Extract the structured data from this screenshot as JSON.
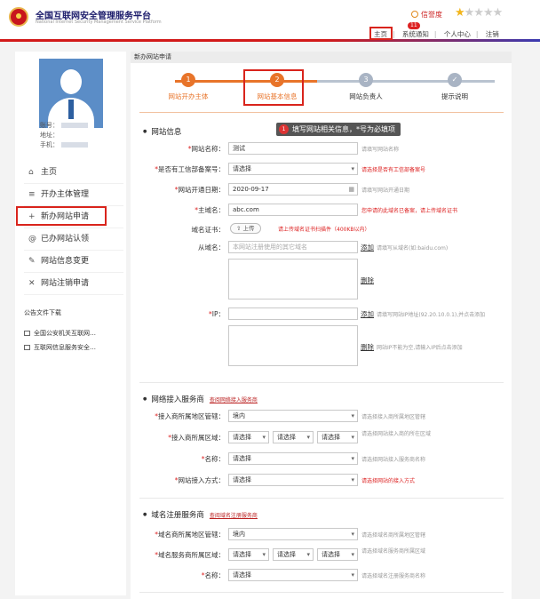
{
  "header": {
    "title": "全国互联网安全管理服务平台",
    "subtitle": "National Internet Security Management Service Platform",
    "credit_label": "信誉度",
    "stars": "★",
    "stars_off": "★★★★",
    "nav": {
      "home": "主页",
      "notify": "系统通知",
      "notify_badge": "11",
      "personal": "个人中心",
      "logout": "注销"
    }
  },
  "sidebar": {
    "account_label": "账号：",
    "address_label": "地址：",
    "phone_label": "手机：",
    "menu": [
      {
        "icon": "⌂",
        "label": "主页"
      },
      {
        "icon": "≡",
        "label": "开办主体管理"
      },
      {
        "icon": "+",
        "label": "新办网站申请"
      },
      {
        "icon": "@",
        "label": "已办网站认领"
      },
      {
        "icon": "✎",
        "label": "网站信息变更"
      },
      {
        "icon": "✕",
        "label": "网站注销申请"
      }
    ],
    "notice_title": "公告文件下载",
    "notices": [
      "全国公安机关互联网…",
      "互联网信息服务安全…"
    ]
  },
  "main": {
    "breadcrumb": "新办网站申请",
    "steps": [
      {
        "num": "1",
        "label": "网站开办主体"
      },
      {
        "num": "2",
        "label": "网站基本信息"
      },
      {
        "num": "3",
        "label": "网站负责人"
      },
      {
        "num": "✓",
        "label": "提示说明"
      }
    ],
    "tip_num": "1",
    "tip": "填写网站相关信息，*号为必填项",
    "s1_title": "网站信息",
    "f_name_label": "网站名称：",
    "f_name_val": "测试",
    "f_name_hint": "请填写网站名称",
    "f_icp_label": "是否有工信部备案号：",
    "f_icp_val": "请选择",
    "f_icp_hint": "请选择是否有工信部备案号",
    "f_date_label": "网站开通日期：",
    "f_date_val": "2020-09-17",
    "f_date_hint": "请填写网站开通日期",
    "f_domain_label": "主域名：",
    "f_domain_val": "abc.com",
    "f_domain_hint": "您申请的此域名已备案，请上传域名证书",
    "f_cert_label": "域名证书：",
    "f_cert_btn": "上传",
    "f_cert_hint": "请上传域名证书扫描件（400KB以内）",
    "f_sub_label": "从域名：",
    "f_sub_ph": "本网站注册使用的其它域名",
    "f_add": "添加",
    "f_sub_hint": "请填写从域名(如:baidu.com)",
    "f_del": "删除",
    "f_ip_label": "IP：",
    "f_ip_hint": "请填写网站IP地址(92.20.10.0.1),并点击添加",
    "f_ip_del_hint": "网站IP不能为空,请输入IP后点击添加",
    "s2_title": "网络接入服务商",
    "s2_link": "查阅网络接入服务商",
    "a_area_label": "接入商所属地区管辖：",
    "a_area_val": "境内",
    "a_area_hint": "请选择接入商所属地区管辖",
    "a_region_label": "接入商所属区域：",
    "sel": "请选择",
    "a_region_hint": "请选择网站接入商的所在区域",
    "a_name_label": "名称：",
    "a_name_hint": "请选择网站接入服务商名称",
    "a_mode_label": "网站接入方式：",
    "a_mode_hint": "请选择网站的接入方式",
    "s3_title": "域名注册服务商",
    "s3_link": "查阅域名注册服务商",
    "d_area_label": "域名商所属地区管辖：",
    "d_area_val": "境内",
    "d_area_hint": "请选择域名商所属地区管辖",
    "d_region_label": "域名服务商所属区域：",
    "d_region_hint": "请选择域名服务商所属区域",
    "d_name_label": "名称：",
    "d_name_hint": "请选择域名注册服务商名称"
  },
  "colors": {
    "accent": "#e8742a",
    "danger": "#d9241c",
    "inactive": "#a9b4c4"
  }
}
